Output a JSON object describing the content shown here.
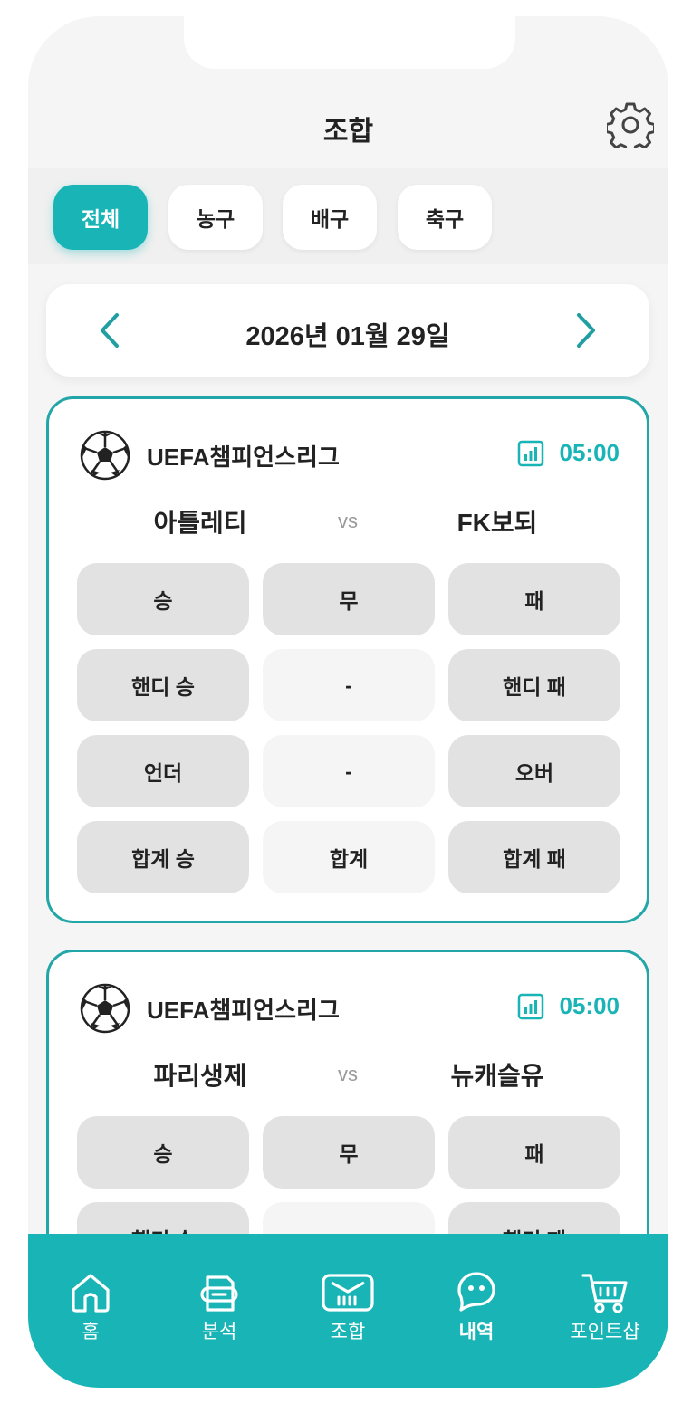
{
  "header": {
    "title": "조합"
  },
  "filters": [
    {
      "label": "전체",
      "active": true
    },
    {
      "label": "농구",
      "active": false
    },
    {
      "label": "배구",
      "active": false
    },
    {
      "label": "축구",
      "active": false
    }
  ],
  "date": {
    "text": "2026년 01월 29일"
  },
  "matches": [
    {
      "league": "UEFA챔피언스리그",
      "time": "05:00",
      "home": "아틀레티",
      "vs": "vs",
      "away": "FK보되",
      "rows": [
        [
          "승",
          "무",
          "패"
        ],
        [
          "핸디 승",
          "-",
          "핸디 패"
        ],
        [
          "언더",
          "-",
          "오버"
        ],
        [
          "합계 승",
          "합계",
          "합계 패"
        ]
      ]
    },
    {
      "league": "UEFA챔피언스리그",
      "time": "05:00",
      "home": "파리생제",
      "vs": "vs",
      "away": "뉴캐슬유",
      "rows": [
        [
          "승",
          "무",
          "패"
        ],
        [
          "핸디 승",
          "-",
          "핸디 패"
        ]
      ]
    }
  ],
  "tabbar": [
    {
      "label": "홈",
      "icon": "home-icon"
    },
    {
      "label": "분석",
      "icon": "analysis-icon"
    },
    {
      "label": "조합",
      "icon": "combo-icon"
    },
    {
      "label": "내역",
      "icon": "history-icon",
      "active": true
    },
    {
      "label": "포인트샵",
      "icon": "cart-icon"
    }
  ],
  "colors": {
    "accent": "#19b4b6",
    "cardBorder": "#23a6a8",
    "cell": "#e2e2e2",
    "cellLight": "#f5f5f5"
  }
}
